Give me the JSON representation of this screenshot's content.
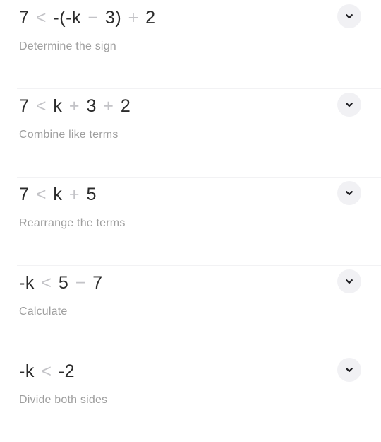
{
  "theme": {
    "background": "#ffffff",
    "expression_color": "#2b2b2b",
    "operator_color": "#c3c3c7",
    "caption_color": "#9e9e9e",
    "divider_color": "#f2f2f4",
    "button_background": "#f1f1f4",
    "chevron_color": "#1f1f23"
  },
  "steps": [
    {
      "expression_parts": [
        {
          "text": "7",
          "muted": false
        },
        {
          "text": "<",
          "muted": true
        },
        {
          "text": "-(-k",
          "muted": false
        },
        {
          "text": "−",
          "muted": true
        },
        {
          "text": "3)",
          "muted": false
        },
        {
          "text": "+",
          "muted": true
        },
        {
          "text": "2",
          "muted": false
        }
      ],
      "expression_plain": "7 < -(-k − 3) + 2",
      "caption": "Determine the sign",
      "toggle_icon": "chevron-down-icon"
    },
    {
      "expression_parts": [
        {
          "text": "7",
          "muted": false
        },
        {
          "text": "<",
          "muted": true
        },
        {
          "text": "k",
          "muted": false
        },
        {
          "text": "+",
          "muted": true
        },
        {
          "text": "3",
          "muted": false
        },
        {
          "text": "+",
          "muted": true
        },
        {
          "text": "2",
          "muted": false
        }
      ],
      "expression_plain": "7 < k + 3 + 2",
      "caption": "Combine like terms",
      "toggle_icon": "chevron-down-icon"
    },
    {
      "expression_parts": [
        {
          "text": "7",
          "muted": false
        },
        {
          "text": "<",
          "muted": true
        },
        {
          "text": "k",
          "muted": false
        },
        {
          "text": "+",
          "muted": true
        },
        {
          "text": "5",
          "muted": false
        }
      ],
      "expression_plain": "7 < k + 5",
      "caption": "Rearrange the terms",
      "toggle_icon": "chevron-down-icon"
    },
    {
      "expression_parts": [
        {
          "text": "-k",
          "muted": false
        },
        {
          "text": "<",
          "muted": true
        },
        {
          "text": "5",
          "muted": false
        },
        {
          "text": "−",
          "muted": true
        },
        {
          "text": "7",
          "muted": false
        }
      ],
      "expression_plain": "-k < 5 − 7",
      "caption": "Calculate",
      "toggle_icon": "chevron-down-icon"
    },
    {
      "expression_parts": [
        {
          "text": "-k",
          "muted": false
        },
        {
          "text": "<",
          "muted": true
        },
        {
          "text": "-2",
          "muted": false
        }
      ],
      "expression_plain": "-k < -2",
      "caption": "Divide both sides",
      "toggle_icon": "chevron-down-icon"
    }
  ]
}
